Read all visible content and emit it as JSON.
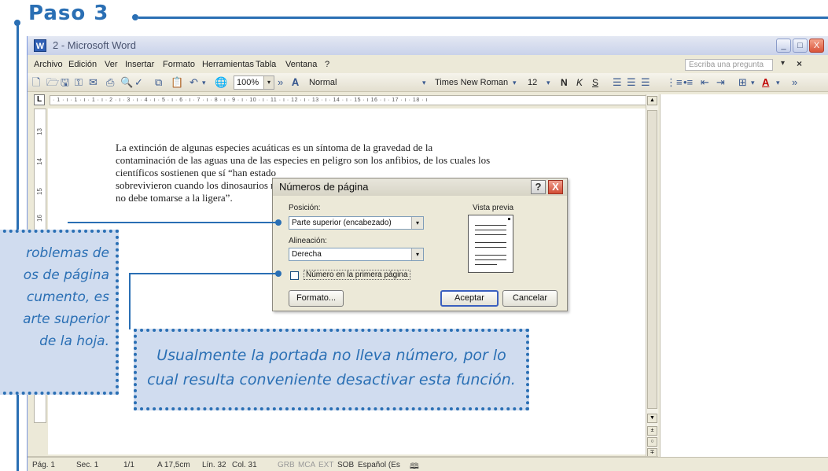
{
  "step": {
    "title": "Paso 3"
  },
  "window": {
    "title": "2 - Microsoft Word",
    "icon_letter": "W",
    "controls": {
      "minimize": "_",
      "maximize": "□",
      "close": "X"
    }
  },
  "menubar": {
    "items": [
      "Archivo",
      "Edición",
      "Ver",
      "Insertar",
      "Formato",
      "Herramientas",
      "Tabla",
      "Ventana",
      "?"
    ],
    "help_placeholder": "Escriba una pregunta",
    "help_arrow": "▾",
    "close_doc": "×"
  },
  "toolbar": {
    "zoom": "100%",
    "style": "Normal",
    "font": "Times New Roman",
    "size": "12",
    "bold": "N",
    "italic": "K",
    "underline": "S",
    "more": "»",
    "dropdown_arrow": "▾",
    "font_color": "A"
  },
  "ruler": {
    "corner": "L",
    "ticks": "· 1 · ı · 1 · ı · 1 · ı · 2 · ı · 3 · ı · 4 · ı · 5 · ı · 6 · ı · 7 · ı · 8 · ı · 9 · ı · 10 · ı · 11 · ı · 12 · ı · 13 · ı · 14 · ı · 15 · ı 16 · ı · 17 · ı · 18 · ı",
    "vertical": [
      "13",
      "14",
      "15",
      "16"
    ]
  },
  "document": {
    "lines": [
      "La extinción de algunas especies acuáticas es un síntoma de la gravedad de la",
      "contaminación de las aguas una de las especies en peligro son los anfibios, de los cuales los",
      "científicos sostienen que sí “han estado",
      "sobrevivieron cuando los dinosaurios n",
      "no debe tomarse a la ligera”."
    ]
  },
  "dialog": {
    "title": "Números de página",
    "help": "?",
    "close": "X",
    "position_label": "Posición:",
    "position_value": "Parte superior (encabezado)",
    "alignment_label": "Alineación:",
    "alignment_value": "Derecha",
    "first_page_label": "Número en la primera página",
    "first_page_checked": false,
    "preview_label": "Vista previa",
    "format_button": "Formato...",
    "ok_button": "Aceptar",
    "cancel_button": "Cancelar"
  },
  "statusbar": {
    "page": "Pág. 1",
    "section": "Sec. 1",
    "pages": "1/1",
    "position": "A 17,5cm",
    "line": "Lín. 32",
    "column": "Col. 31",
    "grb": "GRB",
    "mca": "MCA",
    "ext": "EXT",
    "sob": "SOB",
    "language": "Español (Es",
    "book_icon": "🕮"
  },
  "scroll": {
    "up": "▲",
    "down": "▼",
    "prev": "±",
    "select": "○",
    "next": "∓",
    "left": "◂",
    "right": "▸",
    "views": "≡ ◫ ▭ ▤"
  },
  "callouts": {
    "left_lines": [
      "roblemas de",
      "os de página",
      "cumento, es",
      "arte superior",
      "de la hoja."
    ],
    "bottom_lines": [
      "Usualmente la portada no lleva número, por lo",
      "cual resulta conveniente desactivar esta función."
    ]
  }
}
